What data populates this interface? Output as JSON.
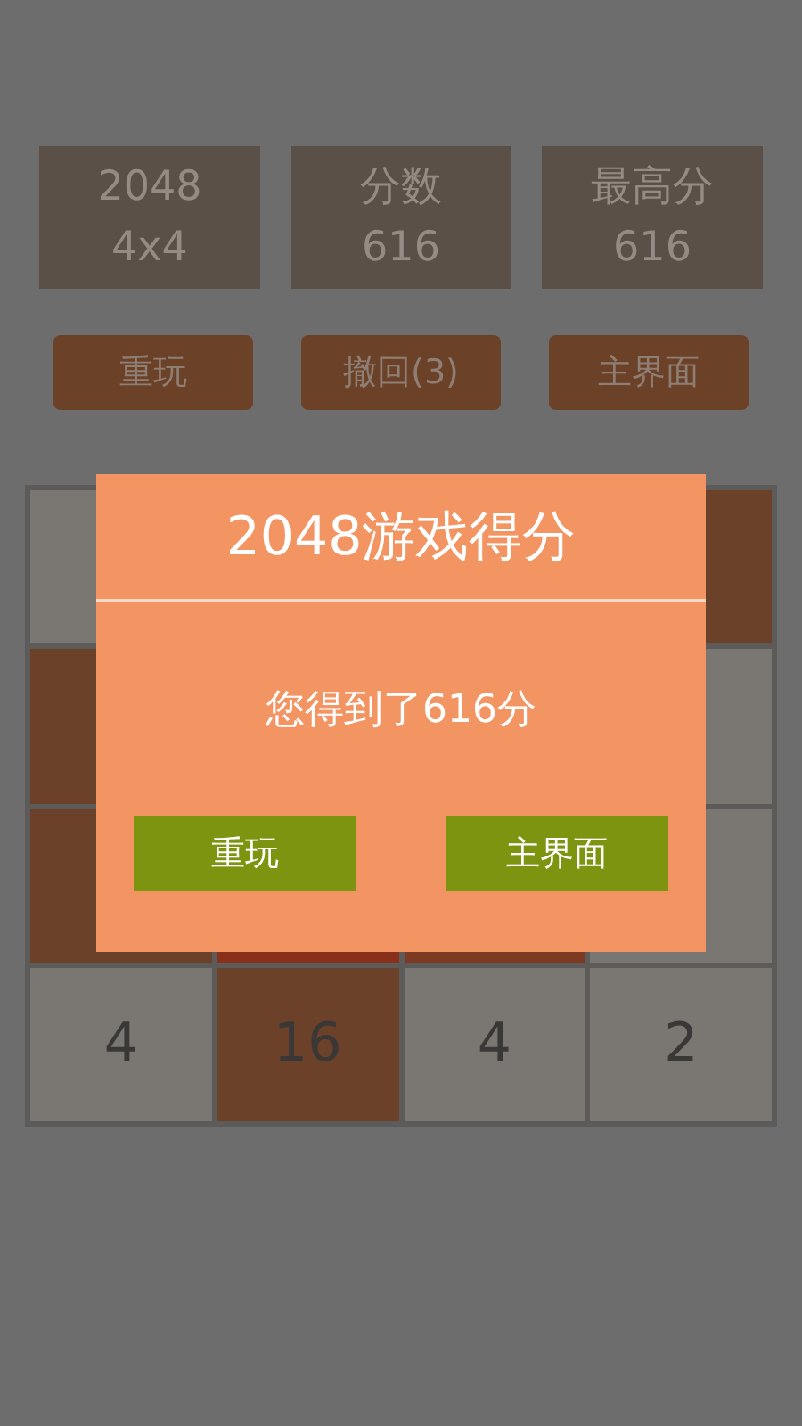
{
  "stats": [
    {
      "label": "2048",
      "value": "4x4"
    },
    {
      "label": "分数",
      "value": "616"
    },
    {
      "label": "最高分",
      "value": "616"
    }
  ],
  "actions": [
    "重玩",
    "撤回(3)",
    "主界面"
  ],
  "board": {
    "rows": [
      {
        "tiles": [
          {
            "color": "#7a7672"
          },
          {
            "color": "#6b4129"
          }
        ]
      },
      {
        "tiles": [
          {
            "color": "#6b4129"
          },
          {
            "color": "#7a7672"
          }
        ]
      },
      {
        "tiles": [
          {
            "color": "#6b4129"
          },
          {
            "color": "#8a2f1a"
          },
          {
            "color": "#7d3a22"
          },
          {
            "color": "#7a7672"
          }
        ]
      },
      {
        "tiles": [
          {
            "color": "#7a7672",
            "value": "4"
          },
          {
            "color": "#6b4129",
            "value": "16"
          },
          {
            "color": "#7a7672",
            "value": "4"
          },
          {
            "color": "#7a7672",
            "value": "2"
          }
        ]
      }
    ]
  },
  "dialog": {
    "title": "2048游戏得分",
    "message": "您得到了616分",
    "buttons": [
      "重玩",
      "主界面"
    ]
  }
}
